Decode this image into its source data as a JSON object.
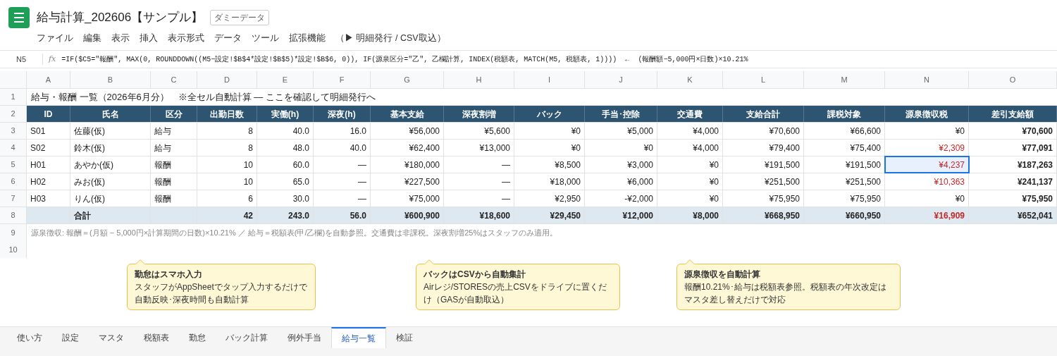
{
  "doc": {
    "title": "給与計算_202606【サンプル】",
    "badge": "ダミーデータ"
  },
  "menu": [
    "ファイル",
    "編集",
    "表示",
    "挿入",
    "表示形式",
    "データ",
    "ツール",
    "拡張機能",
    "（▶ 明細発行 / CSV取込）"
  ],
  "formula_bar": {
    "cell_ref": "N5",
    "fx": "fx",
    "formula": "=IF($C5=\"報酬\", MAX(0, ROUNDDOWN((M5−設定!$B$4*設定!$B$5)*設定!$B$6, 0)), IF(源泉区分=\"乙\", 乙欄計算, INDEX(税額表, MATCH(M5, 税額表, 1))))  ←  (報酬額−5,000円×日数)×10.21%"
  },
  "columns": [
    "A",
    "B",
    "C",
    "D",
    "E",
    "F",
    "G",
    "H",
    "I",
    "J",
    "K",
    "L",
    "M",
    "N",
    "O"
  ],
  "rows": [
    {
      "num": "1",
      "kind": "title",
      "text": "給与・報酬 一覧（2026年6月分）　※全セル自動計算 — ここを確認して明細発行へ"
    },
    {
      "num": "2",
      "kind": "header",
      "cells": [
        "ID",
        "氏名",
        "区分",
        "出勤日数",
        "実働(h)",
        "深夜(h)",
        "基本支給",
        "深夜割増",
        "バック",
        "手当･控除",
        "交通費",
        "支給合計",
        "課税対象",
        "源泉徴収税",
        "差引支給額"
      ]
    },
    {
      "num": "3",
      "kind": "data",
      "alert": false,
      "selected": false,
      "cells": [
        "S01",
        "佐藤(仮)",
        "給与",
        "8",
        "40.0",
        "16.0",
        "¥56,000",
        "¥5,600",
        "¥0",
        "¥5,000",
        "¥4,000",
        "¥70,600",
        "¥66,600",
        "¥0",
        "¥70,600"
      ]
    },
    {
      "num": "4",
      "kind": "data",
      "alert": true,
      "selected": false,
      "cells": [
        "S02",
        "鈴木(仮)",
        "給与",
        "8",
        "48.0",
        "40.0",
        "¥62,400",
        "¥13,000",
        "¥0",
        "¥0",
        "¥4,000",
        "¥79,400",
        "¥75,400",
        "¥2,309",
        "¥77,091"
      ]
    },
    {
      "num": "5",
      "kind": "data",
      "alert": true,
      "selected": true,
      "cells": [
        "H01",
        "あやか(仮)",
        "報酬",
        "10",
        "60.0",
        "—",
        "¥180,000",
        "—",
        "¥8,500",
        "¥3,000",
        "¥0",
        "¥191,500",
        "¥191,500",
        "¥4,237",
        "¥187,263"
      ]
    },
    {
      "num": "6",
      "kind": "data",
      "alert": true,
      "selected": false,
      "cells": [
        "H02",
        "みお(仮)",
        "報酬",
        "10",
        "65.0",
        "—",
        "¥227,500",
        "—",
        "¥18,000",
        "¥6,000",
        "¥0",
        "¥251,500",
        "¥251,500",
        "¥10,363",
        "¥241,137"
      ]
    },
    {
      "num": "7",
      "kind": "data",
      "alert": false,
      "selected": false,
      "cells": [
        "H03",
        "りん(仮)",
        "報酬",
        "6",
        "30.0",
        "—",
        "¥75,000",
        "—",
        "¥2,950",
        "-¥2,000",
        "¥0",
        "¥75,950",
        "¥75,950",
        "¥0",
        "¥75,950"
      ]
    },
    {
      "num": "8",
      "kind": "total",
      "alert": true,
      "selected": false,
      "cells": [
        "",
        "合計",
        "",
        "42",
        "243.0",
        "56.0",
        "¥600,900",
        "¥18,600",
        "¥29,450",
        "¥12,000",
        "¥8,000",
        "¥668,950",
        "¥660,950",
        "¥16,909",
        "¥652,041"
      ]
    },
    {
      "num": "9",
      "kind": "note",
      "text": "源泉徴収: 報酬＝(月額 − 5,000円×計算期間の日数)×10.21% ／ 給与＝税額表(甲/乙欄)を自動参照。交通費は非課税。深夜割増25%はスタッフのみ適用。"
    },
    {
      "num": "10",
      "kind": "empty"
    }
  ],
  "callouts": [
    {
      "title": "勤怠はスマホ入力",
      "body": "スタッフがAppSheetでタップ入力するだけで自動反映･深夜時間も自動計算"
    },
    {
      "title": "バックはCSVから自動集計",
      "body": "Airレジ/STORESの売上CSVをドライブに置くだけ（GASが自動取込）"
    },
    {
      "title": "源泉徴収を自動計算",
      "body": "報酬10.21%･給与は税額表参照。税額表の年次改定はマスタ差し替えだけで対応"
    }
  ],
  "sheet_tabs": [
    {
      "label": "使い方",
      "selected": false
    },
    {
      "label": "設定",
      "selected": false
    },
    {
      "label": "マスタ",
      "selected": false
    },
    {
      "label": "税額表",
      "selected": false
    },
    {
      "label": "勤怠",
      "selected": false
    },
    {
      "label": "バック計算",
      "selected": false
    },
    {
      "label": "例外手当",
      "selected": false
    },
    {
      "label": "給与一覧",
      "selected": true
    },
    {
      "label": "検証",
      "selected": false
    }
  ]
}
